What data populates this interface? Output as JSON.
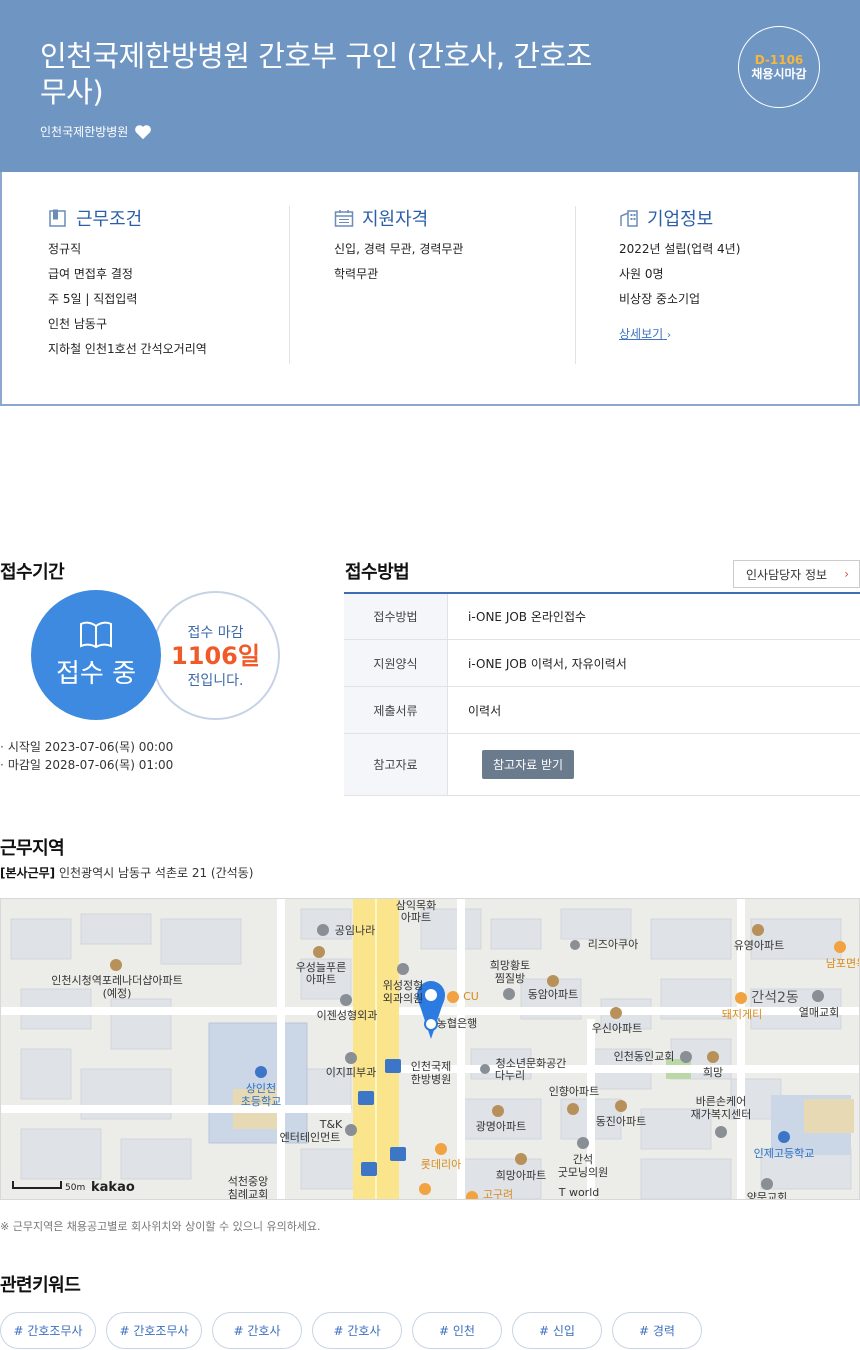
{
  "header": {
    "title": "인천국제한방병원 간호부 구인 (간호사, 간호조무사)",
    "company": "인천국제한방병원",
    "dday": "D-1106",
    "dday_status": "채용시마감"
  },
  "info": {
    "work": {
      "title": "근무조건",
      "lines": [
        "정규직",
        "급여 면접후 결정",
        "주 5일 | 직접입력",
        "인천 남동구",
        "지하철 인천1호선 간석오거리역"
      ]
    },
    "qualification": {
      "title": "지원자격",
      "lines": [
        "신입, 경력 무관, 경력무관",
        "학력무관"
      ]
    },
    "company": {
      "title": "기업정보",
      "lines": [
        "2022년 설립(업력 4년)",
        "사원 0명",
        "비상장 중소기업"
      ],
      "detail_link": "상세보기"
    }
  },
  "period": {
    "title": "접수기간",
    "status": "접수 중",
    "deadline_l1": "접수 마감",
    "deadline_days": "1106일",
    "deadline_l3": "전입니다.",
    "start": "시작일 2023-07-06(목) 00:00",
    "end": "마감일 2028-07-06(목) 01:00"
  },
  "method": {
    "title": "접수방법",
    "hr_button": "인사담당자 정보",
    "rows": [
      {
        "key": "접수방법",
        "value": "i-ONE JOB 온라인접수"
      },
      {
        "key": "지원양식",
        "value": "i-ONE JOB 이력서, 자유이력서"
      },
      {
        "key": "제출서류",
        "value": "이력서"
      },
      {
        "key": "참고자료",
        "button": "참고자료 받기"
      }
    ]
  },
  "area": {
    "title": "근무지역",
    "tag": "[본사근무]",
    "address": "인천광역시 남동구 석촌로 21 (간석동)",
    "note": "※ 근무지역은 채용공고별로 회사위치와 상이할 수 있으니 유의하세요.",
    "map": {
      "scale": "50m",
      "brand": "kakao",
      "marker_label": "인천국제\n한방병원",
      "labels": [
        "삼익목화\n아파트",
        "공임나라",
        "우성늘푸른\n아파트",
        "인천시청역포레나더샵아파트\n(예정)",
        "위성정형\n외과의원",
        "CU",
        "희망황토\n찜질방",
        "동암아파트",
        "리즈아쿠아",
        "유영아파트",
        "남포면옥",
        "간석2동",
        "돼지게티",
        "열매교회",
        "이젠성형외과",
        "농협은행",
        "우신아파트",
        "인천동인교회",
        "희망",
        "청소년문화공간\n다누리",
        "이지피부과",
        "상인천\n초등학교",
        "인향아파트",
        "T&K\n엔터테인먼트",
        "광명아파트",
        "동진아파트",
        "바른손케어\n재가복지센터",
        "롯데리아",
        "희망아파트",
        "간석\n굿모닝의원",
        "인제고등학교",
        "석천중앙\n침례교회",
        "고구려",
        "T world",
        "양문교회"
      ]
    }
  },
  "keywords": {
    "title": "관련키워드",
    "items": [
      "# 간호조무사",
      "# 간호조무사",
      "# 간호사",
      "# 간호사",
      "# 인천",
      "# 신입",
      "# 경력"
    ]
  }
}
